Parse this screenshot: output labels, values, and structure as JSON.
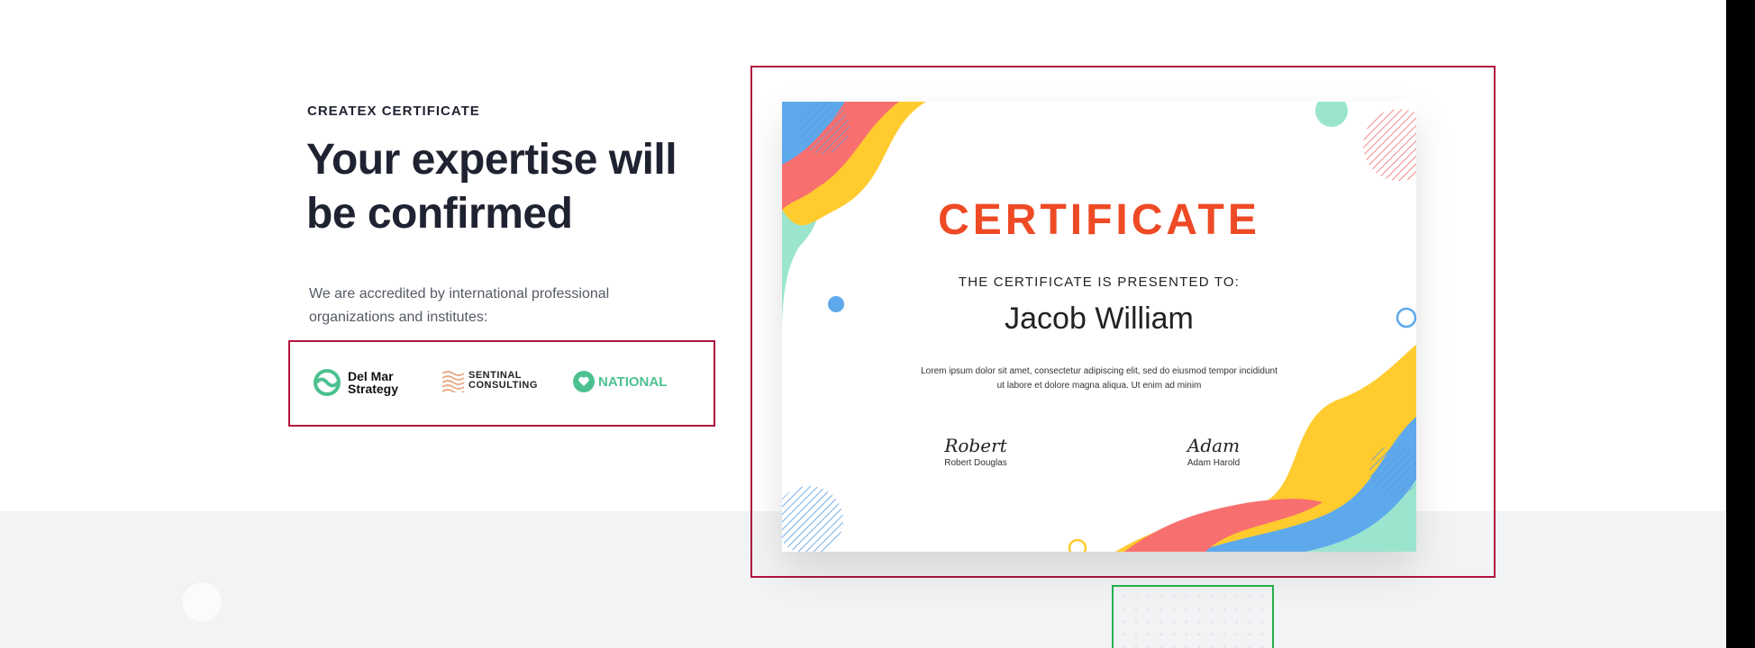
{
  "hero": {
    "eyebrow": "CREATEX CERTIFICATE",
    "headline": "Your expertise will be confirmed",
    "description": "We are accredited by international professional organizations and institutes:"
  },
  "logos": [
    {
      "name": "delmar",
      "line1": "Del Mar",
      "line2": "Strategy",
      "color": "#4cc18f"
    },
    {
      "name": "sentinal",
      "line1": "SENTINAL",
      "line2": "CONSULTING",
      "color": "#e8a27a"
    },
    {
      "name": "national",
      "line1": "NATIONAL",
      "color": "#4cc18f"
    }
  ],
  "certificate": {
    "title": "CERTIFICATE",
    "presented_to": "THE CERTIFICATE IS PRESENTED TO:",
    "recipient": "Jacob William",
    "body": "Lorem ipsum dolor sit amet, consectetur adipiscing elit, sed do eiusmod tempor incididunt ut labore et dolore magna aliqua. Ut enim ad minim",
    "signatures": [
      {
        "script": "Robert",
        "name": "Robert Douglas"
      },
      {
        "script": "Adam",
        "name": "Adam Harold"
      }
    ]
  },
  "colors": {
    "heading": "#1f2230",
    "accent_orange": "#ee4a25",
    "highlight_red": "#b0153f",
    "highlight_green": "#22b14c",
    "mint": "#4cc18f"
  }
}
